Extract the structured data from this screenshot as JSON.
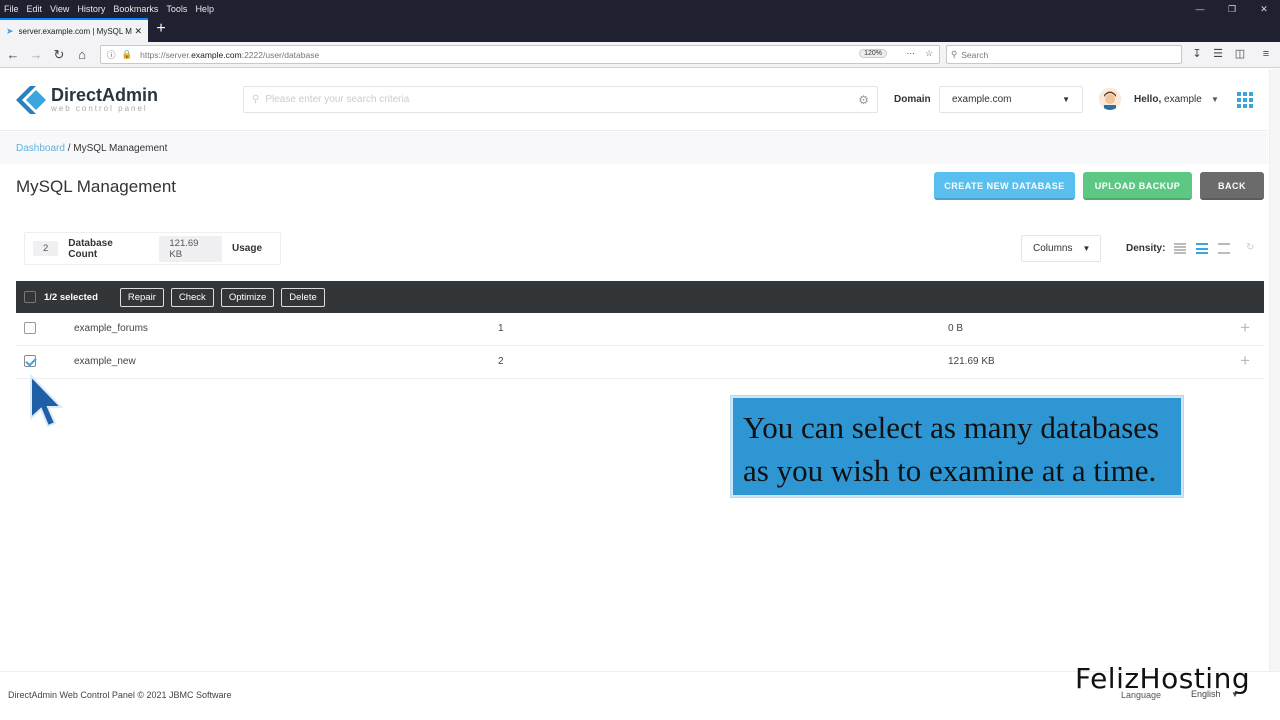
{
  "browser": {
    "menu": [
      "File",
      "Edit",
      "View",
      "History",
      "Bookmarks",
      "Tools",
      "Help"
    ],
    "tab_title": "server.example.com | MySQL M",
    "url_prefix": "https://server.",
    "url_host": "example.com",
    "url_rest": ":2222/user/database",
    "zoom": "120%",
    "search_placeholder": "Search"
  },
  "header": {
    "logo_title": "DirectAdmin",
    "logo_sub": "web control panel",
    "search_placeholder": "Please enter your search criteria",
    "domain_label": "Domain",
    "domain_value": "example.com",
    "hello": "Hello,",
    "username": "example"
  },
  "breadcrumb": {
    "home": "Dashboard",
    "sep": " / ",
    "current": "MySQL Management"
  },
  "page": {
    "title": "MySQL Management",
    "create_label": "CREATE NEW DATABASE",
    "upload_label": "UPLOAD BACKUP",
    "back_label": "BACK"
  },
  "stats": {
    "db_count": "2",
    "db_count_label": "Database Count",
    "usage": "121.69 KB",
    "usage_label": "Usage"
  },
  "toolbar": {
    "columns_label": "Columns",
    "density_label": "Density:",
    "selected": "1/2 selected",
    "actions": [
      "Repair",
      "Check",
      "Optimize",
      "Delete"
    ]
  },
  "rows": [
    {
      "name": "example_forums",
      "users": "1",
      "size": "0 B",
      "checked": false
    },
    {
      "name": "example_new",
      "users": "2",
      "size": "121.69 KB",
      "checked": true
    }
  ],
  "caption": {
    "line1": "You can select as many databases",
    "line2": "as you wish to examine at a time."
  },
  "footer": {
    "copyright": "DirectAdmin Web Control Panel © 2021 JBMC Software",
    "language_label": "Language",
    "language_value": "English"
  },
  "watermark": "FelizHosting",
  "colors": {
    "accent": "#3aa6dd",
    "create": "#58bfee",
    "upload": "#5cc884",
    "back": "#6b6b6b",
    "toolbar": "#333638"
  }
}
